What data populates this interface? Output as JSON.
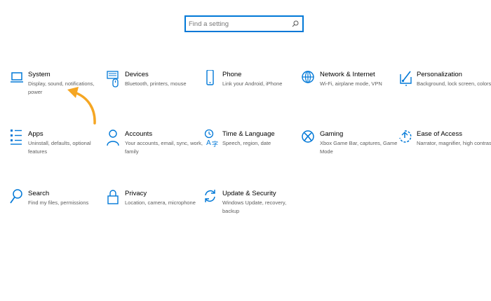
{
  "search": {
    "placeholder": "Find a setting",
    "value": ""
  },
  "tiles": [
    {
      "title": "System",
      "description": "Display, sound, notifications, power",
      "icon": "laptop-icon"
    },
    {
      "title": "Devices",
      "description": "Bluetooth, printers, mouse",
      "icon": "devices-icon"
    },
    {
      "title": "Phone",
      "description": "Link your Android, iPhone",
      "icon": "phone-icon"
    },
    {
      "title": "Network & Internet",
      "description": "Wi-Fi, airplane mode, VPN",
      "icon": "globe-icon"
    },
    {
      "title": "Personalization",
      "description": "Background, lock screen, colors",
      "icon": "personalization-icon"
    },
    {
      "title": "Apps",
      "description": "Uninstall, defaults, optional features",
      "icon": "apps-list-icon"
    },
    {
      "title": "Accounts",
      "description": "Your accounts, email, sync, work, family",
      "icon": "person-icon"
    },
    {
      "title": "Time & Language",
      "description": "Speech, region, date",
      "icon": "time-language-icon"
    },
    {
      "title": "Gaming",
      "description": "Xbox Game Bar, captures, Game Mode",
      "icon": "xbox-icon"
    },
    {
      "title": "Ease of Access",
      "description": "Narrator, magnifier, high contrast",
      "icon": "ease-of-access-icon"
    },
    {
      "title": "Search",
      "description": "Find my files, permissions",
      "icon": "search-icon"
    },
    {
      "title": "Privacy",
      "description": "Location, camera, microphone",
      "icon": "lock-icon"
    },
    {
      "title": "Update & Security",
      "description": "Windows Update, recovery, backup",
      "icon": "update-icon"
    }
  ],
  "colors": {
    "accent": "#0078d7",
    "annotation_arrow": "#f5a623"
  }
}
